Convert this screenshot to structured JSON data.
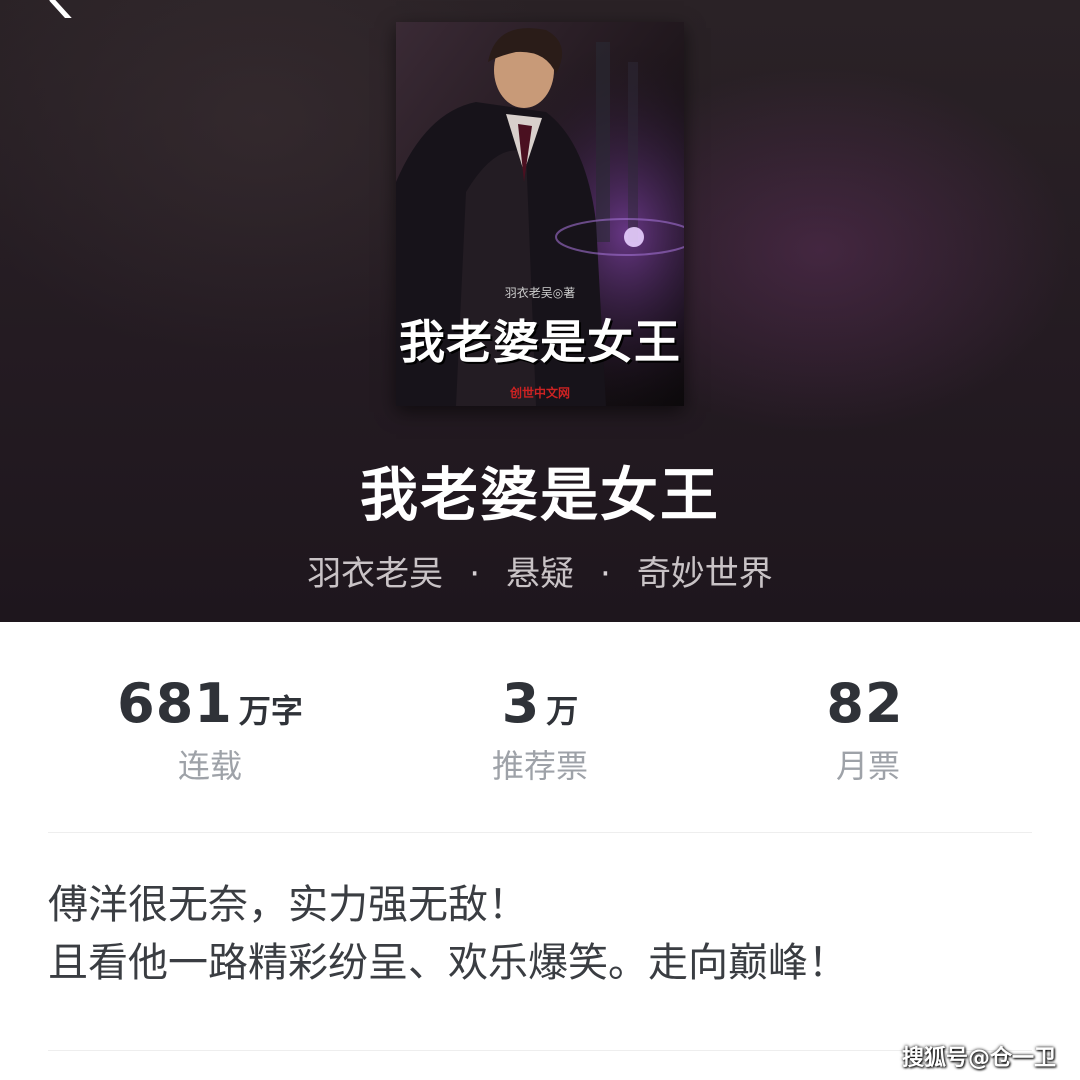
{
  "header": {
    "back_icon": "chevron-left-icon"
  },
  "cover": {
    "author_line": "羽衣老吴◎著",
    "title": "我老婆是女王",
    "publisher": "创世中文网"
  },
  "book": {
    "title": "我老婆是女王",
    "author": "羽衣老吴",
    "separator": "·",
    "category": "悬疑",
    "subcategory": "奇妙世界"
  },
  "stats": [
    {
      "number": "681",
      "unit": "万字",
      "label": "连载"
    },
    {
      "number": "3",
      "unit": "万",
      "label": "推荐票"
    },
    {
      "number": "82",
      "unit": "",
      "label": "月票"
    }
  ],
  "description": {
    "line1": "傅洋很无奈，实力强无敌！",
    "line2": "且看他一路精彩纷呈、欢乐爆笑。走向巅峰！"
  },
  "watermark": "搜狐号@仓一卫",
  "colors": {
    "hero_bg": "#241b22",
    "stat_number": "#2f3238",
    "stat_label": "#9ea2a8",
    "description_text": "#3a3d42"
  }
}
